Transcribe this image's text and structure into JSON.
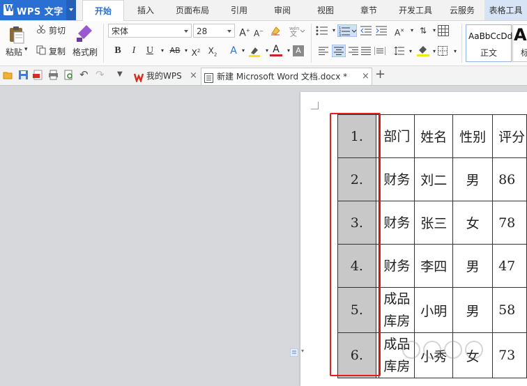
{
  "app": {
    "title": "WPS 文字"
  },
  "menu_tabs": [
    {
      "label": "开始",
      "active": true
    },
    {
      "label": "插入"
    },
    {
      "label": "页面布局"
    },
    {
      "label": "引用"
    },
    {
      "label": "审阅"
    },
    {
      "label": "视图"
    },
    {
      "label": "章节"
    },
    {
      "label": "开发工具"
    },
    {
      "label": "云服务"
    },
    {
      "label": "表格工具"
    }
  ],
  "ribbon": {
    "paste_label": "粘贴",
    "cut_label": "剪切",
    "copy_label": "复制",
    "format_painter_label": "格式刷",
    "font_name": "宋体",
    "font_size": "28",
    "style_preview_text": "AaBbCcDd",
    "style_normal_label": "正文",
    "style_heading_preview": "Aa",
    "style_heading_label": "标"
  },
  "doc_tabs": [
    {
      "label": "我的WPS"
    },
    {
      "label": "新建 Microsoft Word 文档.docx *",
      "active": true
    }
  ],
  "table": {
    "rows": [
      {
        "num": "1.",
        "dept": "部门",
        "name": "姓名",
        "sex": "性别",
        "score": "评分"
      },
      {
        "num": "2.",
        "dept": "财务",
        "name": "刘二",
        "sex": "男",
        "score": "86"
      },
      {
        "num": "3.",
        "dept": "财务",
        "name": "张三",
        "sex": "女",
        "score": "78"
      },
      {
        "num": "4.",
        "dept": "财务",
        "name": "李四",
        "sex": "男",
        "score": "47"
      },
      {
        "num": "5.",
        "dept": "成品库房",
        "name": "小明",
        "sex": "男",
        "score": "58"
      },
      {
        "num": "6.",
        "dept": "成品库房",
        "name": "小秀",
        "sex": "女",
        "score": "73"
      }
    ]
  },
  "colors": {
    "accent": "#2a6fd4",
    "highlight_border": "#e02020",
    "numbered_cell_bg": "#c8c8c8"
  }
}
